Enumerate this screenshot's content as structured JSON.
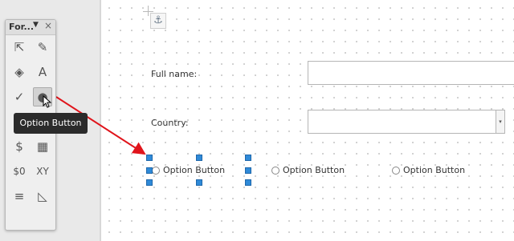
{
  "toolbar": {
    "title": "For...",
    "menu_glyph": "▼",
    "close_glyph": "×",
    "tools": [
      {
        "name": "select-pointer-icon",
        "glyph": "⇱",
        "active": false
      },
      {
        "name": "form-design-mode-icon",
        "glyph": "✎",
        "active": false
      },
      {
        "name": "label-tag-icon",
        "glyph": "◈",
        "active": false
      },
      {
        "name": "text-label-icon",
        "glyph": "A",
        "active": false
      },
      {
        "name": "checkbox-icon",
        "glyph": "✓",
        "active": false
      },
      {
        "name": "option-button-icon",
        "glyph": "●",
        "active": true
      },
      {
        "name": "push-button-icon",
        "glyph": "▭",
        "active": false
      },
      {
        "name": "image-control-icon",
        "glyph": "▤",
        "active": false
      },
      {
        "name": "currency-field-icon",
        "glyph": "$",
        "active": false
      },
      {
        "name": "date-field-icon",
        "glyph": "▦",
        "active": false
      },
      {
        "name": "formatted-field-icon",
        "glyph": "$0",
        "active": false
      },
      {
        "name": "xy-field-icon",
        "glyph": "XY",
        "active": false
      },
      {
        "name": "list-box-icon",
        "glyph": "≡",
        "active": false
      },
      {
        "name": "grid-position-icon",
        "glyph": "◺",
        "active": false
      }
    ]
  },
  "tooltip": "Option Button",
  "anchor_glyph": "⚓",
  "form": {
    "full_name_label": "Full name:",
    "full_name_value": "",
    "country_label": "Country:",
    "country_value": "",
    "option_buttons": [
      "Option Button",
      "Option Button",
      "Option Button"
    ]
  },
  "colors": {
    "arrow": "#e0141b",
    "selection_handle": "#2f8ad8",
    "tooltip_bg": "#2b2b2b"
  }
}
